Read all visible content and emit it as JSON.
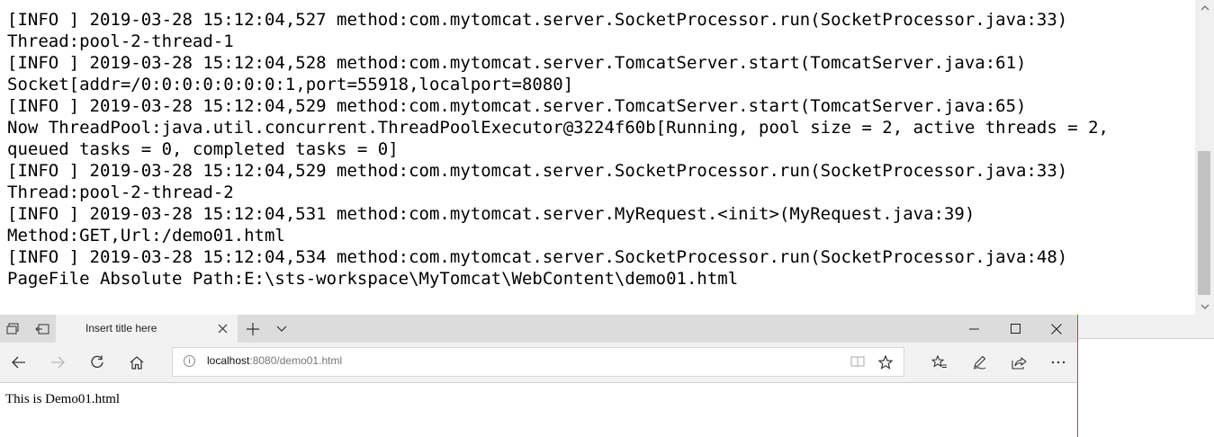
{
  "console": {
    "lines": [
      "[INFO ] 2019-03-28 15:12:04,527 method:com.mytomcat.server.SocketProcessor.run(SocketProcessor.java:33)",
      "Thread:pool-2-thread-1",
      "[INFO ] 2019-03-28 15:12:04,528 method:com.mytomcat.server.TomcatServer.start(TomcatServer.java:61)",
      "Socket[addr=/0:0:0:0:0:0:0:1,port=55918,localport=8080]",
      "[INFO ] 2019-03-28 15:12:04,529 method:com.mytomcat.server.TomcatServer.start(TomcatServer.java:65)",
      "Now ThreadPool:java.util.concurrent.ThreadPoolExecutor@3224f60b[Running, pool size = 2, active threads = 2,",
      "queued tasks = 0, completed tasks = 0]",
      "[INFO ] 2019-03-28 15:12:04,529 method:com.mytomcat.server.SocketProcessor.run(SocketProcessor.java:33)",
      "Thread:pool-2-thread-2",
      "[INFO ] 2019-03-28 15:12:04,531 method:com.mytomcat.server.MyRequest.<init>(MyRequest.java:39)",
      "Method:GET,Url:/demo01.html",
      "[INFO ] 2019-03-28 15:12:04,534 method:com.mytomcat.server.SocketProcessor.run(SocketProcessor.java:48)",
      "PageFile Absolute Path:E:\\sts-workspace\\MyTomcat\\WebContent\\demo01.html"
    ],
    "scrollbar": {
      "up_icon": "chevron-up-icon",
      "down_icon": "chevron-down-icon"
    }
  },
  "browser": {
    "tab": {
      "title": "Insert title here"
    },
    "address": {
      "host": "localhost",
      "rest": ":8080/demo01.html"
    },
    "page": {
      "text": "This is Demo01.html"
    },
    "icons": {
      "tab_set_aside": "tabs-icon",
      "tab_preview": "tab-preview-icon",
      "close_tab": "close-icon",
      "new_tab": "plus-icon",
      "tab_list": "chevron-down-icon",
      "minimize": "minimize-icon",
      "maximize": "maximize-icon",
      "close_window": "close-icon",
      "back": "back-arrow-icon",
      "forward": "forward-arrow-icon",
      "refresh": "refresh-icon",
      "home": "home-icon",
      "site_info": "info-icon",
      "reading_view": "book-icon",
      "favorite": "star-icon",
      "favorites_hub": "favorites-icon",
      "notes": "pen-icon",
      "share": "share-icon",
      "more": "more-icon"
    },
    "colors": {
      "window_border": "#2b79d6",
      "titlebar": "#dcdcdc",
      "toolbar": "#f2f2f2"
    }
  }
}
